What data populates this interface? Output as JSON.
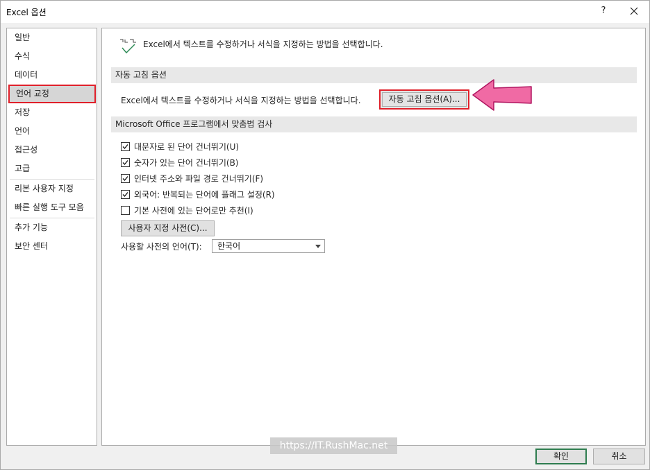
{
  "window": {
    "title": "Excel 옵션",
    "help_label": "?"
  },
  "sidebar": {
    "items": [
      {
        "label": "일반"
      },
      {
        "label": "수식"
      },
      {
        "label": "데이터"
      },
      {
        "label": "언어 교정",
        "selected": true
      },
      {
        "label": "저장"
      },
      {
        "label": "언어"
      },
      {
        "label": "접근성"
      },
      {
        "label": "고급"
      },
      {
        "label": "리본 사용자 지정"
      },
      {
        "label": "빠른 실행 도구 모음"
      },
      {
        "label": "추가 기능"
      },
      {
        "label": "보안 센터"
      }
    ]
  },
  "main": {
    "header_text": "Excel에서 텍스트를 수정하거나 서식을 지정하는 방법을 선택합니다.",
    "autocorrect_section": {
      "title": "자동 고침 옵션",
      "description": "Excel에서 텍스트를 수정하거나 서식을 지정하는 방법을 선택합니다.",
      "button_label": "자동 고침 옵션(A)..."
    },
    "spelling_section": {
      "title": "Microsoft Office 프로그램에서 맞춤법 검사",
      "options": [
        {
          "label": "대문자로 된 단어 건너뛰기(U)",
          "checked": true
        },
        {
          "label": "숫자가 있는 단어 건너뛰기(B)",
          "checked": true
        },
        {
          "label": "인터넷 주소와 파일 경로 건너뛰기(F)",
          "checked": true
        },
        {
          "label": "외국어: 반복되는 단어에 플래그 설정(R)",
          "checked": true
        },
        {
          "label": "기본 사전에 있는 단어로만 추천(I)",
          "checked": false
        }
      ],
      "custom_dict_button": "사용자 지정 사전(C)...",
      "dict_language_label": "사용할 사전의 언어(T):",
      "dict_language_value": "한국어"
    }
  },
  "footer": {
    "ok_label": "확인",
    "cancel_label": "취소"
  },
  "watermark": "https://IT.RushMac.net",
  "colors": {
    "highlight_border": "#e0202a",
    "arrow_fill": "#f06aa4",
    "ok_border": "#2e7d4f"
  }
}
